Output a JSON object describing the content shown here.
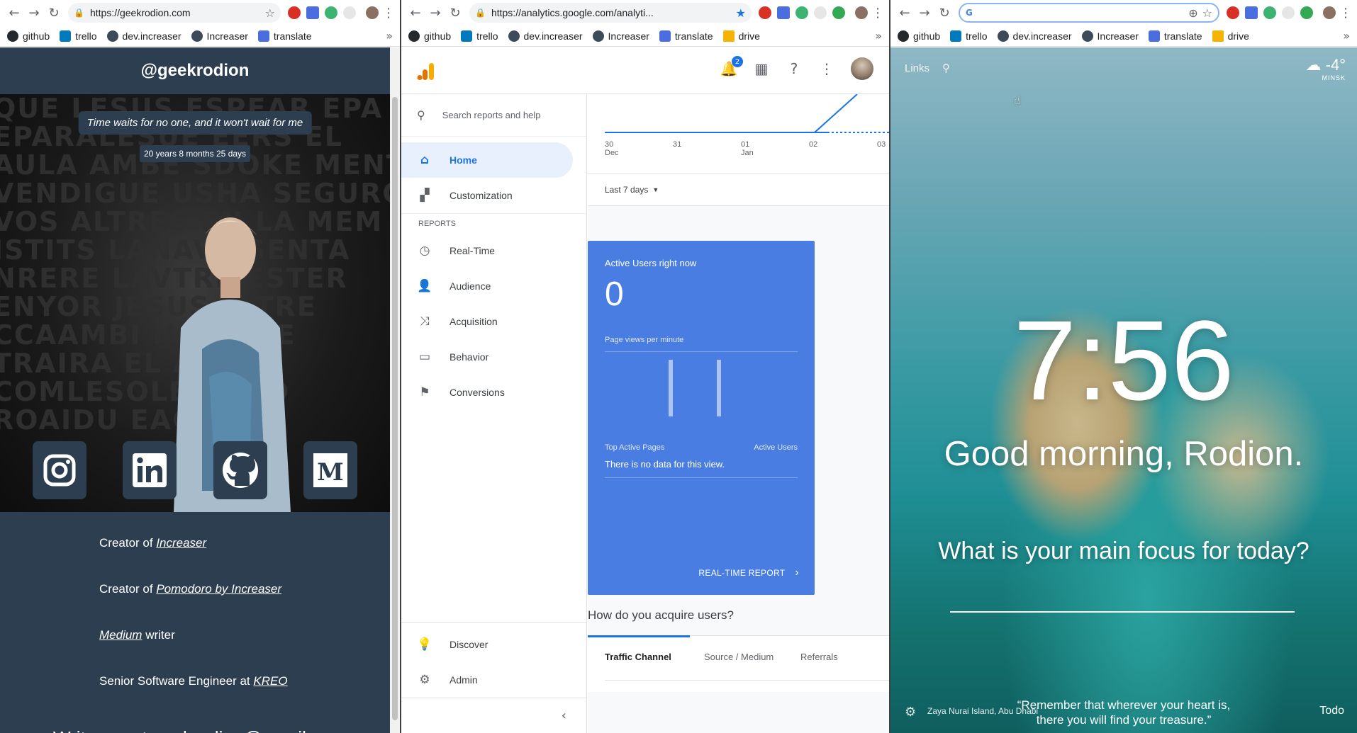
{
  "bookmarks": [
    "github",
    "trello",
    "dev.increaser",
    "Increaser",
    "translate",
    "drive"
  ],
  "bookmark_colors": [
    "#24292e",
    "#0079bf",
    "#3c4a5a",
    "#3c4a5a",
    "#4a6ee0",
    "#f4b400"
  ],
  "window1": {
    "url": "https://geekrodion.com",
    "handle": "@geekrodion",
    "quote": "Time waits for no one, and it won't wait for me",
    "age": "20 years 8 months 25 days",
    "socials": [
      "instagram-icon",
      "linkedin-icon",
      "github-icon",
      "medium-icon"
    ],
    "bio": [
      {
        "prefix": "Creator of ",
        "link": "Increaser",
        "suffix": ""
      },
      {
        "prefix": "Creator of ",
        "link": "Pomodoro by Increaser",
        "suffix": ""
      },
      {
        "prefix": "",
        "link": "Medium",
        "suffix": " writer"
      },
      {
        "prefix": "Senior Software Engineer at ",
        "link": "KREO",
        "suffix": ""
      }
    ],
    "write_me": "Write me at geekrodion@gmail.com",
    "bg_color": "#2c3e50"
  },
  "window2": {
    "url": "https://analytics.google.com/analyti...",
    "notifications": "2",
    "search_placeholder": "Search reports and help",
    "nav": {
      "home": "Home",
      "customization": "Customization",
      "reports_label": "REPORTS",
      "realtime": "Real-Time",
      "audience": "Audience",
      "acquisition": "Acquisition",
      "behavior": "Behavior",
      "conversions": "Conversions",
      "discover": "Discover",
      "admin": "Admin"
    },
    "chart": {
      "ticks": [
        [
          "30",
          "Dec"
        ],
        [
          "31",
          ""
        ],
        [
          "01",
          "Jan"
        ],
        [
          "02",
          ""
        ],
        [
          "03",
          ""
        ]
      ]
    },
    "range": "Last 7 days",
    "realtime_card": {
      "title": "Active Users right now",
      "value": "0",
      "pageviews_label": "Page views per minute",
      "bars": [
        0,
        0,
        0,
        0,
        0,
        0,
        0,
        0,
        0,
        0,
        0,
        0,
        0,
        0,
        0,
        0,
        0,
        0,
        0,
        0,
        0,
        0,
        0,
        0,
        0,
        0,
        0,
        0,
        0,
        0,
        0,
        0,
        0,
        1,
        0,
        0,
        0,
        0,
        0,
        0,
        0,
        0,
        0,
        0,
        0,
        0,
        0,
        0,
        0,
        0,
        0,
        0,
        0,
        0,
        0,
        0,
        0,
        0,
        1,
        0,
        0,
        0,
        0,
        0,
        0,
        0,
        0,
        0,
        0,
        0,
        0,
        0,
        0,
        0,
        0,
        0,
        0,
        0,
        0,
        0,
        0,
        0,
        0,
        0,
        0,
        0,
        0,
        0,
        0,
        0,
        0,
        0,
        0,
        0,
        0,
        0,
        0,
        0,
        0,
        0
      ],
      "top_pages_label": "Top Active Pages",
      "active_users_label": "Active Users",
      "no_data": "There is no data for this view.",
      "link": "REAL-TIME REPORT",
      "color": "#4a7de2"
    },
    "acquire_title": "How do you acquire users?",
    "tabs": [
      "Traffic Channel",
      "Source / Medium",
      "Referrals"
    ]
  },
  "window3": {
    "links": "Links",
    "temp": "-4°",
    "city": "MINSK",
    "time": "7:56",
    "greeting": "Good morning, Rodion.",
    "focus_question": "What is your main focus for today?",
    "location": "Zaya Nurai Island, Abu Dhabi",
    "quote_line1": "“Remember that wherever your heart is,",
    "quote_line2": "there you will find your treasure.”",
    "todo": "Todo"
  }
}
